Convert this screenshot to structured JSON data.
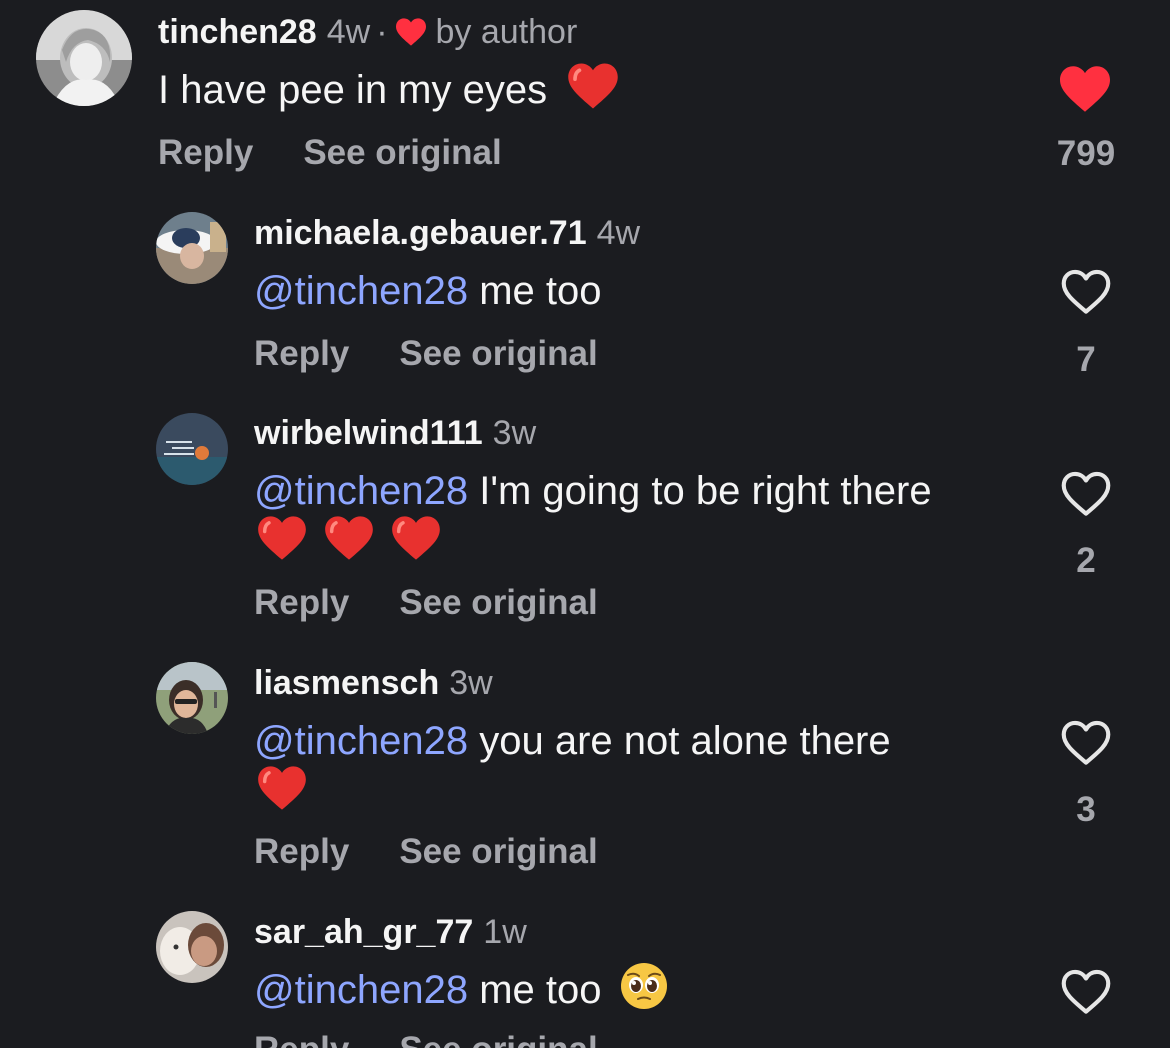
{
  "comments": [
    {
      "username": "tinchen28",
      "time": "4w",
      "separator": "·",
      "badge": "by author",
      "text": "I have pee in my eyes",
      "reply_label": "Reply",
      "see_original_label": "See original",
      "like_count": "799",
      "liked": true
    },
    {
      "username": "michaela.gebauer.71",
      "time": "4w",
      "mention": "@tinchen28",
      "text": "me too",
      "reply_label": "Reply",
      "see_original_label": "See original",
      "like_count": "7",
      "liked": false
    },
    {
      "username": "wirbelwind111",
      "time": "3w",
      "mention": "@tinchen28",
      "text": "I'm going to be right there",
      "reply_label": "Reply",
      "see_original_label": "See original",
      "like_count": "2",
      "liked": false
    },
    {
      "username": "liasmensch",
      "time": "3w",
      "mention": "@tinchen28",
      "text": "you are not alone there",
      "reply_label": "Reply",
      "see_original_label": "See original",
      "like_count": "3",
      "liked": false
    },
    {
      "username": "sar_ah_gr_77",
      "time": "1w",
      "mention": "@tinchen28",
      "text": "me too",
      "reply_label": "Reply",
      "see_original_label": "See original",
      "liked": false
    }
  ],
  "colors": {
    "background": "#1b1c20",
    "mention": "#8ea6ff",
    "secondary_text": "#a6a7ad",
    "like_red": "#ff3040"
  },
  "icons": {
    "like_filled": "heart-filled-icon",
    "like_outline": "heart-outline-icon",
    "emoji_heart": "red-heart-emoji",
    "emoji_pleading": "pleading-face-emoji"
  }
}
